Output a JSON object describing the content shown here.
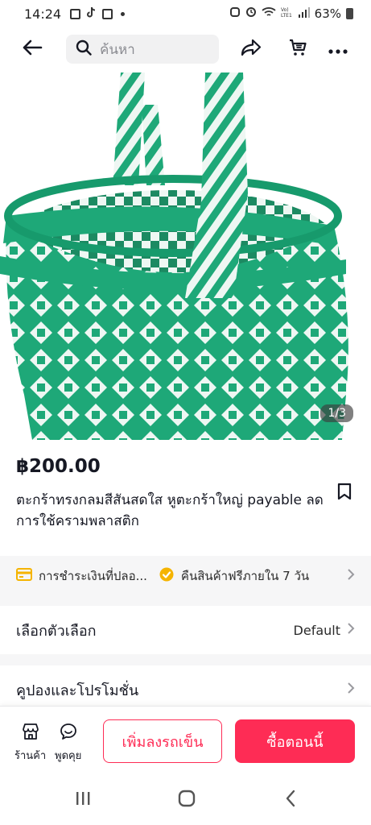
{
  "status_bar": {
    "time": "14:24",
    "battery": "63%"
  },
  "header": {
    "search_placeholder": "ค้นหา"
  },
  "product": {
    "image_counter": "1/3",
    "price": "฿200.00",
    "title": "ตะกร้าทรงกลมสีสันสดใส หูตะกร้าใหญ่ payable ลดการใช้ครามพลาสติก",
    "image_colors": {
      "green": "#1ea878",
      "white": "#eef7f3"
    }
  },
  "services": [
    {
      "icon": "card-icon",
      "label": "การชำระเงินที่ปลอ..."
    },
    {
      "icon": "return-badge-icon",
      "label": "คืนสินค้าฟรีภายใน 7 วัน"
    }
  ],
  "option_row": {
    "label": "เลือกตัวเลือก",
    "value": "Default"
  },
  "coupon_row": {
    "label": "คูปองและโปรโมชั่น"
  },
  "action_bar": {
    "shop_label": "ร้านค้า",
    "chat_label": "พูดคุย",
    "add_to_cart": "เพิ่มลงรถเข็น",
    "buy_now": "ซื้อตอนนี้"
  },
  "colors": {
    "accent": "#fe2c55",
    "service_icon": "#f5b400"
  }
}
